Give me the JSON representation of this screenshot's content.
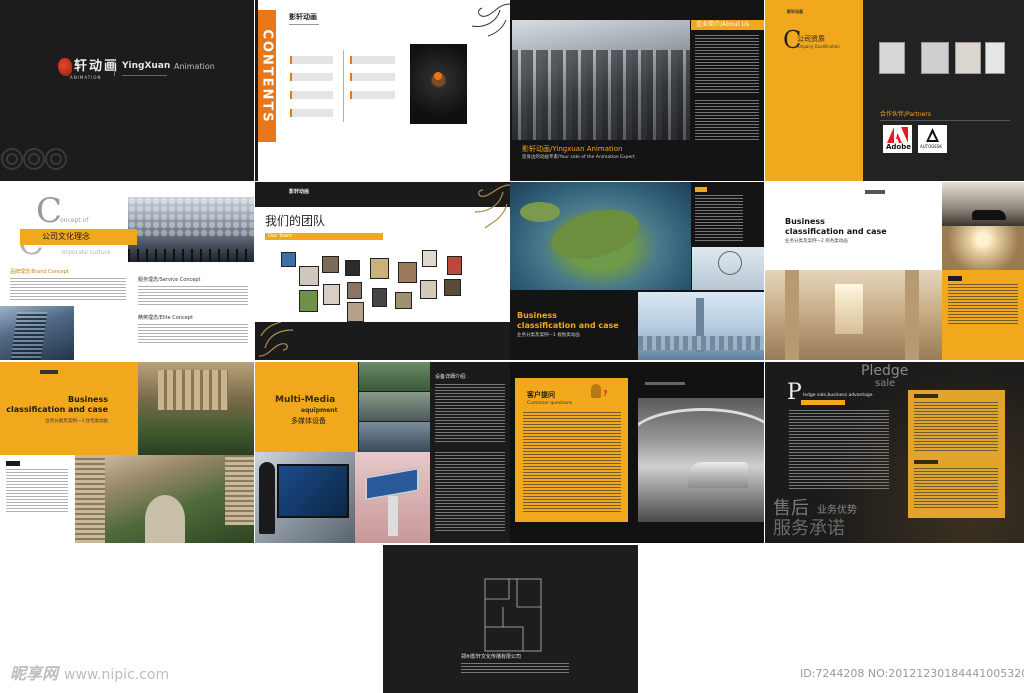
{
  "colors": {
    "accent_yellow": "#f2a81d",
    "accent_orange": "#e8771c",
    "dark": "#1b1b1b"
  },
  "cover": {
    "logo_chars": "轩动画",
    "logo_sub": "ANIMATION",
    "brand_en_1": "YingXuan",
    "brand_en_2": "Animation"
  },
  "contents": {
    "title": "CONTENTS",
    "logo": "影轩动画"
  },
  "about": {
    "header": "企业简介/About Us",
    "brand": "影轩动画/Yingxuan Animation",
    "slogan": "您身边的动画专家/Your side of the Animation Expert"
  },
  "qualification": {
    "logo": "影轩动画",
    "letter": "C",
    "title": "公司资质",
    "subtitle": "ompany Qualification",
    "partners_label": "合作伙伴/Partners",
    "partner_1": "Adobe",
    "partner_2": "AUTODESK"
  },
  "culture": {
    "letter_1": "C",
    "line_1": "oncept of",
    "letter_2": "C",
    "line_2": "orporate culture",
    "title": "公司文化理念",
    "brand_concept": "品牌理念/Brand Concept",
    "service_concept": "服务理念/Service Concept",
    "elite_concept": "精英理念/Elite Concept"
  },
  "team": {
    "logo": "影轩动画",
    "title": "我们的团队",
    "subtitle": "Our Team"
  },
  "case_1": {
    "title_1": "Business",
    "title_2": "classification and case",
    "subtitle": "业务分类及案例—1 规划类动画"
  },
  "case_2": {
    "title_1": "Business",
    "title_2": "classification and case",
    "subtitle": "业务分类及案例—2 商务类动画"
  },
  "case_3": {
    "title_1": "Business",
    "title_2": "classification and case",
    "subtitle": "业务分类及案例—3 住宅类动画"
  },
  "multimedia": {
    "title_1": "Multi-Media",
    "title_2": "equipment",
    "title_cn": "多媒体设备",
    "detail_label": "设备详细介绍:"
  },
  "questions": {
    "title": "客户提问",
    "subtitle": "Customer questions"
  },
  "pledge": {
    "title_1": "Pledge",
    "title_2": "sale",
    "letter": "P",
    "line": "ledge sale,business advantage",
    "big_1": "售后",
    "big_2": "服务承诺",
    "side": "业务优势"
  },
  "back": {
    "company": "郑州影轩文化传播有限公司"
  },
  "watermark": {
    "site_cn": "昵享网",
    "site_url": "www.nipic.com",
    "id_text": "ID:7244208 NO:20121230184441005320"
  }
}
